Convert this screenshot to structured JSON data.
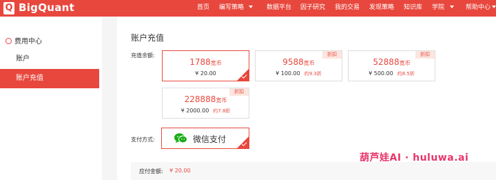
{
  "brand": {
    "logo_letter": "Q",
    "name": "BigQuant"
  },
  "nav": {
    "home": "首页",
    "strategy": "编写策略",
    "data": "数据平台",
    "factor": "因子研究",
    "trade": "我的交易",
    "discover": "发现策略",
    "knowledge": "知识库",
    "academy": "学院",
    "help": "帮助中心"
  },
  "sidebar": {
    "header": "费用中心",
    "items": [
      {
        "label": "账户",
        "active": false
      },
      {
        "label": "账户充值",
        "active": true
      }
    ]
  },
  "main": {
    "title": "账户充值",
    "balance_label": "充值余额:",
    "payment_label": "支付方式:",
    "coin_unit": "宽币",
    "discount_tag": "折扣",
    "packages": [
      {
        "coins": "1788",
        "price": "¥ 20.00",
        "discount": "",
        "selected": true
      },
      {
        "coins": "9588",
        "price": "¥ 100.00",
        "discount": "约9.3折",
        "selected": false
      },
      {
        "coins": "52888",
        "price": "¥ 500.00",
        "discount": "约8.5折",
        "selected": false
      },
      {
        "coins": "228888",
        "price": "¥ 2000.00",
        "discount": "约7.8折",
        "selected": false
      }
    ],
    "payment_method": "微信支付",
    "amount_due_label": "应付金额:",
    "amount_due": "¥ 20.00"
  },
  "watermark": "葫芦娃AI · huluwa.ai",
  "colors": {
    "accent": "#e8473d",
    "wechat": "#1aad19",
    "tag_bg": "#fce6df"
  }
}
